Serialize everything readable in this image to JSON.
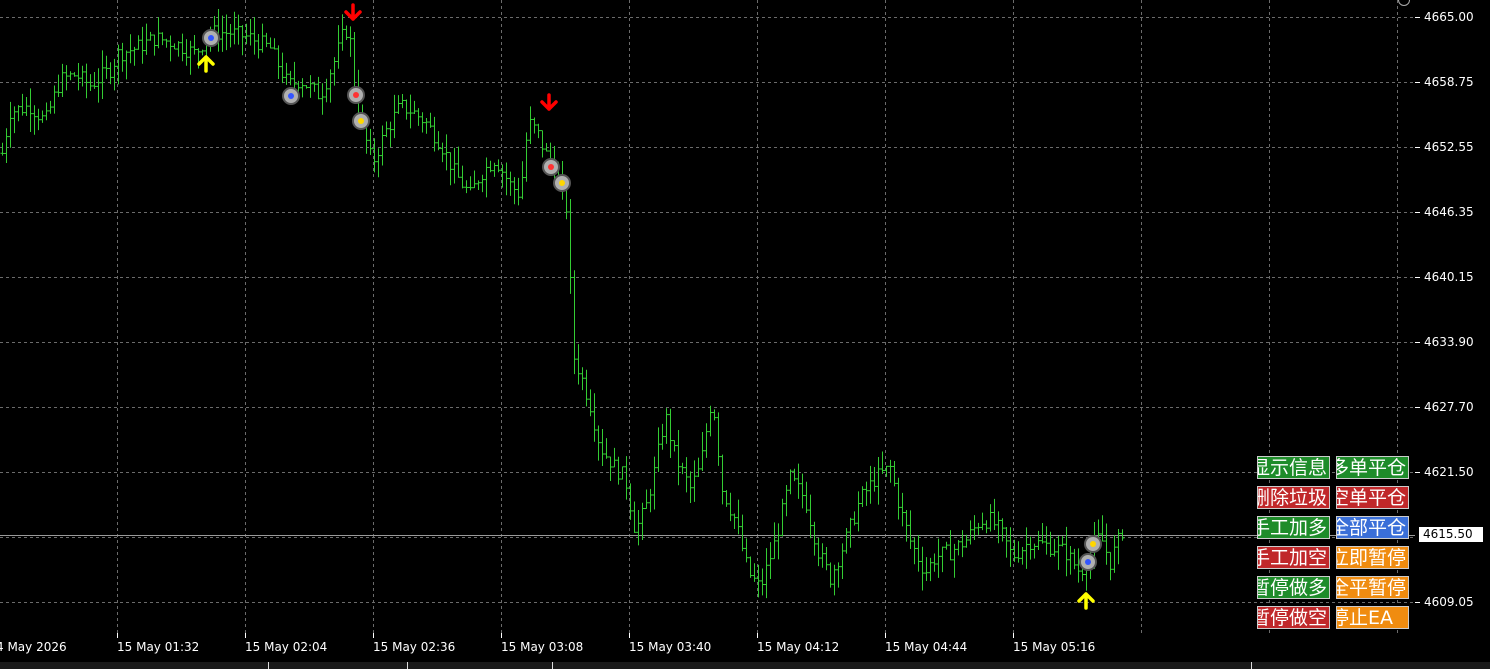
{
  "price_axis": {
    "labels": [
      "4665.00",
      "4658.75",
      "4652.55",
      "4646.35",
      "4640.15",
      "4633.90",
      "4627.70",
      "4621.50",
      "4609.05"
    ],
    "current_price": "4615.50"
  },
  "time_axis": {
    "labels": [
      "4 May 2026",
      "15 May 01:32",
      "15 May 02:04",
      "15 May 02:36",
      "15 May 03:08",
      "15 May 03:40",
      "15 May 04:12",
      "15 May 04:44",
      "15 May 05:16"
    ]
  },
  "ea_panel": {
    "buttons": [
      {
        "label": "显示信息",
        "color": "#1e8c2a"
      },
      {
        "label": "多单平仓",
        "color": "#1e8c2a"
      },
      {
        "label": "删除垃圾",
        "color": "#c0282a"
      },
      {
        "label": "空单平仓",
        "color": "#c0282a"
      },
      {
        "label": "手工加多",
        "color": "#1e8c2a"
      },
      {
        "label": "全部平仓",
        "color": "#3a6fd8"
      },
      {
        "label": "手工加空",
        "color": "#c0282a"
      },
      {
        "label": "立即暂停",
        "color": "#f08c10"
      },
      {
        "label": "暂停做多",
        "color": "#1e8c2a"
      },
      {
        "label": "全平暂停",
        "color": "#f08c10"
      },
      {
        "label": "暂停做空",
        "color": "#c0282a"
      },
      {
        "label": "停止EA",
        "color": "#f08c10"
      }
    ]
  },
  "chart_data": {
    "type": "bar",
    "symbol_color": "#33cc33",
    "grid": true,
    "y_range": [
      4605.0,
      4667.0
    ],
    "signals": [
      {
        "type": "buy-arrow",
        "time": "01:42",
        "price": 4661.0,
        "color": "#ffff00"
      },
      {
        "type": "sell-arrow",
        "time": "02:16",
        "price": 4666.5,
        "color": "#ff0000"
      },
      {
        "type": "sell-arrow",
        "time": "03:00",
        "price": 4657.5,
        "color": "#ff0000"
      },
      {
        "type": "buy-arrow",
        "time": "05:34",
        "price": 4609.3,
        "color": "#ffff00"
      }
    ]
  }
}
